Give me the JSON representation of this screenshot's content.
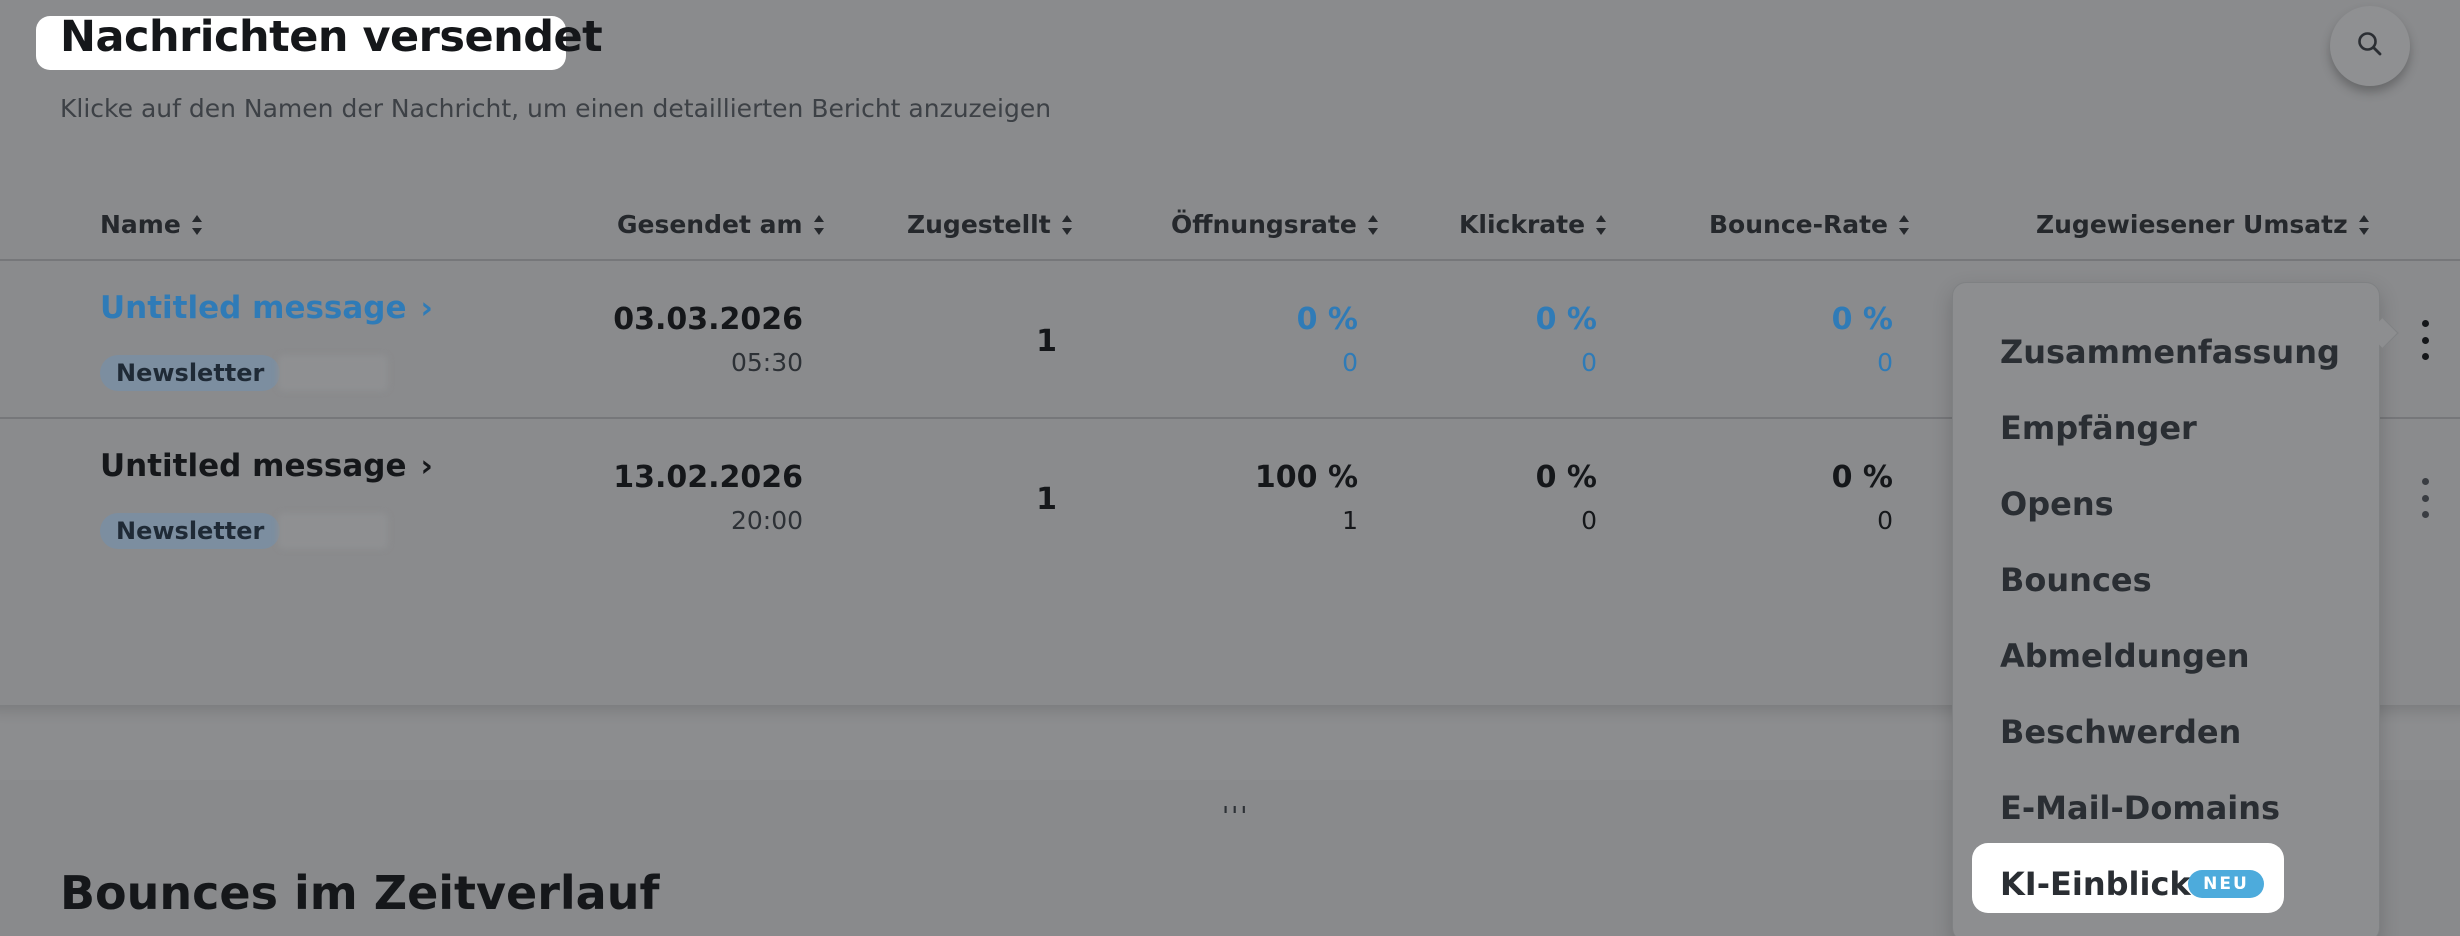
{
  "header": {
    "title": "Nachrichten versendet",
    "subtitle": "Klicke auf den Namen der Nachricht, um einen detaillierten Bericht anzuzeigen",
    "search_icon": "search-icon"
  },
  "table": {
    "columns": [
      {
        "label": "Name"
      },
      {
        "label": "Gesendet am"
      },
      {
        "label": "Zugestellt"
      },
      {
        "label": "Öffnungsrate"
      },
      {
        "label": "Klickrate"
      },
      {
        "label": "Bounce-Rate"
      },
      {
        "label": "Zugewiesener Umsatz"
      }
    ],
    "rows": [
      {
        "name": "Untitled message",
        "tag": "Newsletter",
        "date": "03.03.2026",
        "time": "05:30",
        "delivered": "1",
        "open_rate": "0 %",
        "open_count": "0",
        "click_rate": "0 %",
        "click_count": "0",
        "bounce_rate": "0 %",
        "bounce_count": "0"
      },
      {
        "name": "Untitled message",
        "tag": "Newsletter",
        "date": "13.02.2026",
        "time": "20:00",
        "delivered": "1",
        "open_rate": "100 %",
        "open_count": "1",
        "click_rate": "0 %",
        "click_count": "0",
        "bounce_rate": "0 %",
        "bounce_count": "0"
      }
    ]
  },
  "menu": {
    "items": [
      {
        "label": "Zusammenfassung"
      },
      {
        "label": "Empfänger"
      },
      {
        "label": "Opens"
      },
      {
        "label": "Bounces"
      },
      {
        "label": "Abmeldungen"
      },
      {
        "label": "Beschwerden"
      },
      {
        "label": "E-Mail-Domains"
      },
      {
        "label": "KI-Einblicke",
        "badge": "NEU"
      }
    ]
  },
  "lower": {
    "section_title": "Bounces im Zeitverlauf",
    "resize_handle": "'''"
  },
  "colors": {
    "link_blue": "#2f7bb7",
    "badge_blue": "#4dabdc",
    "overlay_gray": "#8a8b8d"
  }
}
